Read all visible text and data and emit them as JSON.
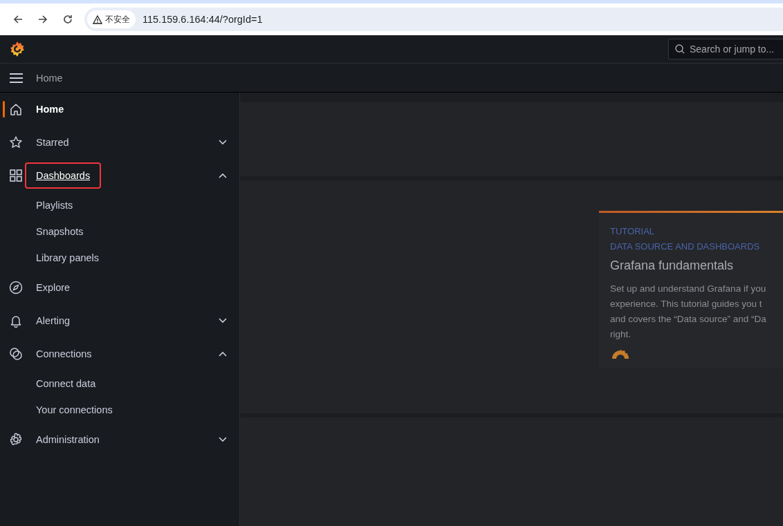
{
  "browser": {
    "security_label": "不安全",
    "url": "115.159.6.164:44/?orgId=1"
  },
  "topbar": {
    "search": {
      "placeholder": "Search or jump to..."
    }
  },
  "breadcrumb": {
    "label": "Home"
  },
  "sidebar": {
    "items": [
      {
        "label": "Home",
        "kind": "home",
        "selected": true,
        "highlighted": false
      },
      {
        "label": "Starred",
        "kind": "star",
        "selected": false,
        "highlighted": false,
        "expanded": false
      },
      {
        "label": "Dashboards",
        "kind": "grid",
        "selected": false,
        "highlighted": true,
        "expanded": true,
        "children": [
          {
            "label": "Playlists"
          },
          {
            "label": "Snapshots"
          },
          {
            "label": "Library panels"
          }
        ]
      },
      {
        "label": "Explore",
        "kind": "compass",
        "selected": false,
        "highlighted": false
      },
      {
        "label": "Alerting",
        "kind": "bell",
        "selected": false,
        "highlighted": false,
        "expanded": false
      },
      {
        "label": "Connections",
        "kind": "link",
        "selected": false,
        "highlighted": false,
        "expanded": true,
        "children": [
          {
            "label": "Connect data"
          },
          {
            "label": "Your connections"
          }
        ]
      },
      {
        "label": "Administration",
        "kind": "gear",
        "selected": false,
        "highlighted": false,
        "expanded": false
      }
    ]
  },
  "tutorial_card": {
    "eyebrow": "TUTORIAL",
    "category": "DATA SOURCE AND DASHBOARDS",
    "title": "Grafana fundamentals",
    "description_lines": [
      "Set up and understand Grafana if you",
      "experience. This tutorial guides you t",
      "and covers the “Data source” and “Da",
      "right."
    ]
  }
}
